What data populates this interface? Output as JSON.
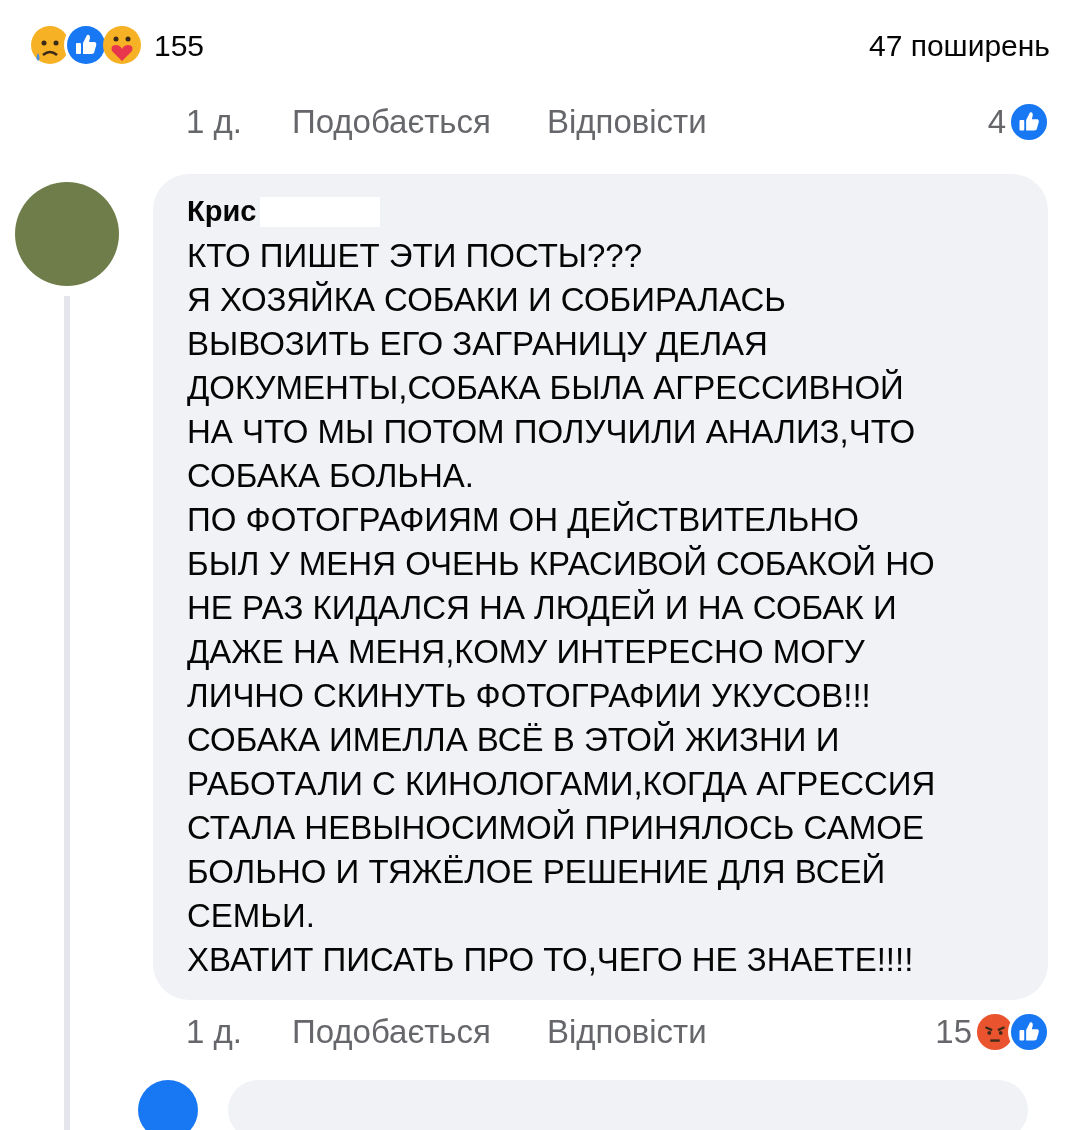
{
  "post_reactions": {
    "icons": [
      {
        "kind": "sad"
      },
      {
        "kind": "like"
      },
      {
        "kind": "care"
      }
    ],
    "count": "155",
    "shares": "47 поширень"
  },
  "previous_comment_actions": {
    "time": "1 д.",
    "like": "Подобається",
    "reply": "Відповісти",
    "reaction_count": "4",
    "icons": [
      {
        "kind": "like"
      }
    ]
  },
  "comment": {
    "author": "Крис",
    "author_redacted": true,
    "lines": [
      "КТО ПИШЕТ ЭТИ ПОСТЫ???",
      "Я ХОЗЯЙКА СОБАКИ И СОБИРАЛАСЬ",
      "ВЫВОЗИТЬ ЕГО ЗАГРАНИЦУ ДЕЛАЯ",
      "ДОКУМЕНТЫ,СОБАКА БЫЛА АГРЕССИВНОЙ",
      "НА ЧТО МЫ ПОТОМ ПОЛУЧИЛИ АНАЛИЗ,ЧТО",
      "СОБАКА БОЛЬНА.",
      "ПО ФОТОГРАФИЯМ ОН ДЕЙСТВИТЕЛЬНО",
      "БЫЛ У МЕНЯ ОЧЕНЬ КРАСИВОЙ СОБАКОЙ НО",
      "НЕ РАЗ КИДАЛСЯ НА ЛЮДЕЙ И НА СОБАК И",
      "ДАЖЕ НА МЕНЯ,КОМУ ИНТЕРЕСНО МОГУ",
      "ЛИЧНО СКИНУТЬ ФОТОГРАФИИ УКУСОВ!!!",
      "СОБАКА ИМЕЛЛА ВСЁ В ЭТОЙ ЖИЗНИ И",
      "РАБОТАЛИ С КИНОЛОГАМИ,КОГДА АГРЕССИЯ",
      "СТАЛА НЕВЫНОСИМОЙ ПРИНЯЛОСЬ САМОЕ",
      "БОЛЬНО И ТЯЖЁЛОЕ РЕШЕНИЕ ДЛЯ ВСЕЙ",
      "СЕМЬИ.",
      "ХВАТИТ ПИСАТЬ ПРО ТО,ЧЕГО НЕ ЗНАЕТЕ!!!!"
    ],
    "actions": {
      "time": "1 д.",
      "like": "Подобається",
      "reply": "Відповісти",
      "reaction_count": "15",
      "icons": [
        {
          "kind": "angry"
        },
        {
          "kind": "like"
        }
      ]
    }
  }
}
